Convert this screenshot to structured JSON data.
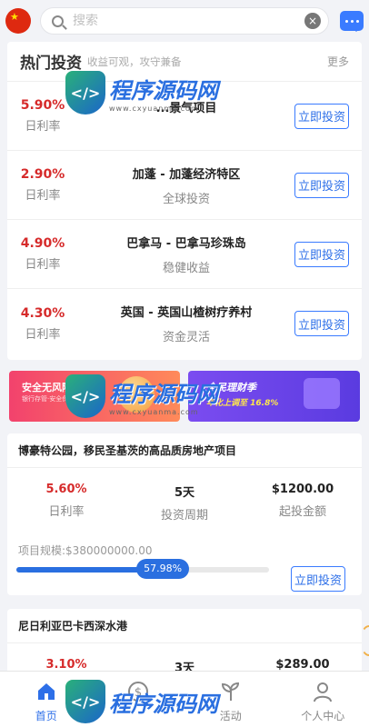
{
  "header": {
    "search_placeholder": "搜索",
    "clear_symbol": "×"
  },
  "hot": {
    "title": "热门投资",
    "subtitle": "收益可观，攻守兼备",
    "more": "更多",
    "items": [
      {
        "rate": "5.90%",
        "rate_label": "日利率",
        "name": "...景气项目",
        "tag": "",
        "button": "立即投资"
      },
      {
        "rate": "2.90%",
        "rate_label": "日利率",
        "name": "加蓬 - 加蓬经济特区",
        "tag": "全球投资",
        "button": "立即投资"
      },
      {
        "rate": "4.90%",
        "rate_label": "日利率",
        "name": "巴拿马 - 巴拿马珍珠岛",
        "tag": "稳健收益",
        "button": "立即投资"
      },
      {
        "rate": "4.30%",
        "rate_label": "日利率",
        "name": "英国 - 英国山楂树疗养村",
        "tag": "资金灵活",
        "button": "立即投资"
      }
    ]
  },
  "banners": {
    "left": {
      "title": "安全无风险",
      "small": "银行存管·安全保障"
    },
    "right": {
      "title": "全民理财季",
      "sub": "年化上调至 16.8%"
    }
  },
  "project1": {
    "title": "博豪特公园，移民圣基茨的高品质房地产项目",
    "rate": "5.60%",
    "rate_label": "日利率",
    "period": "5天",
    "period_label": "投资周期",
    "min": "$1200.00",
    "min_label": "起投金额",
    "scale": "项目规模:$380000000.00",
    "progress_text": "57.98%",
    "progress": 0.5798,
    "button": "立即投资"
  },
  "project2": {
    "title": "尼日利亚巴卡西深水港",
    "rate": "3.10%",
    "period": "3天",
    "min": "$289.00"
  },
  "tabbar": {
    "tabs": [
      {
        "label": "首页",
        "icon": "home-icon",
        "active": true
      },
      {
        "label": "",
        "icon": "dollar-circle-icon",
        "active": false
      },
      {
        "label": "活动",
        "icon": "sprout-icon",
        "active": false
      },
      {
        "label": "个人中心",
        "icon": "person-icon",
        "active": false
      }
    ]
  },
  "watermark": {
    "text": "程序源码网",
    "url": "www.cxyuanma.com"
  },
  "colors": {
    "accent": "#2a6fe0",
    "rate_red": "#d62b2b",
    "background": "#f2f3f7"
  }
}
